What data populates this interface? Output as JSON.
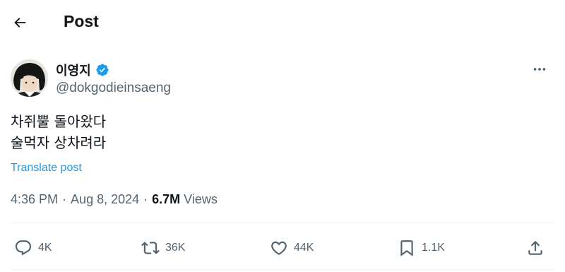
{
  "header": {
    "title": "Post",
    "back_icon": "arrow-left-icon"
  },
  "author": {
    "display_name": "이영지",
    "handle": "@dokgodieinsaeng",
    "verified_color": "#1d9bf0"
  },
  "post": {
    "lines": [
      "차쥐뿔 돌아왔다",
      "술먹자 상차려라"
    ],
    "translate_label": "Translate post",
    "time": "4:36 PM",
    "date": "Aug 8, 2024",
    "separator": "·",
    "views_count": "6.7M",
    "views_label": "Views"
  },
  "actions": {
    "replies": "4K",
    "reposts": "36K",
    "likes": "44K",
    "bookmarks": "1.1K"
  },
  "colors": {
    "accent": "#1d9bf0",
    "text": "#0f1419",
    "muted": "#536471",
    "divider": "#eff3f4"
  }
}
